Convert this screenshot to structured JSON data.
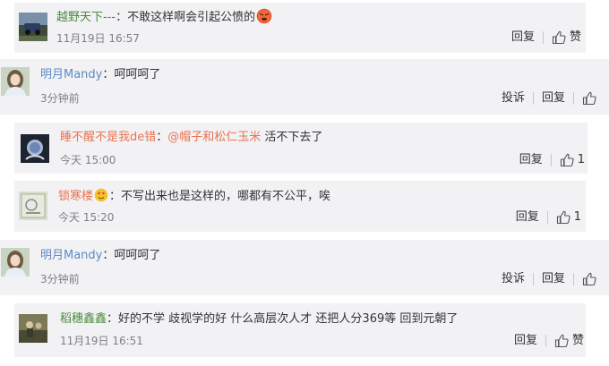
{
  "comments": [
    {
      "user": "越野天下---",
      "sep": "：",
      "text": "不敢这样啊会引起公愤的",
      "emoji": "angry-face",
      "time": "11月19日 16:57",
      "reply": "回复",
      "like": "赞"
    },
    {
      "user": "明月Mandy",
      "sep": "：",
      "text": "呵呵呵了",
      "time": "3分钟前",
      "report": "投诉",
      "reply": "回复"
    },
    {
      "user": "睡不醒不是我de错",
      "sep": "：",
      "mention": "@帽子和松仁玉米",
      "text": " 活不下去了",
      "time": "今天 15:00",
      "reply": "回复",
      "likes": "1"
    },
    {
      "user": "锁寒楼",
      "sep": "：",
      "text": "不写出来也是这样的，哪都有不公平，唉",
      "time": "今天 15:20",
      "reply": "回复",
      "likes": "1"
    },
    {
      "user": "明月Mandy",
      "sep": "：",
      "text": "呵呵呵了",
      "time": "3分钟前",
      "report": "投诉",
      "reply": "回复"
    },
    {
      "user": "稻穗鑫鑫",
      "sep": "：",
      "text": "好的不学  歧视学的好  什么高层次人才  还把人分369等 回到元朝了",
      "time": "11月19日 16:51",
      "reply": "回复",
      "like": "赞"
    }
  ],
  "colors": {
    "username": "#eb7350",
    "background": "#f2f2f5",
    "time": "#808080"
  }
}
